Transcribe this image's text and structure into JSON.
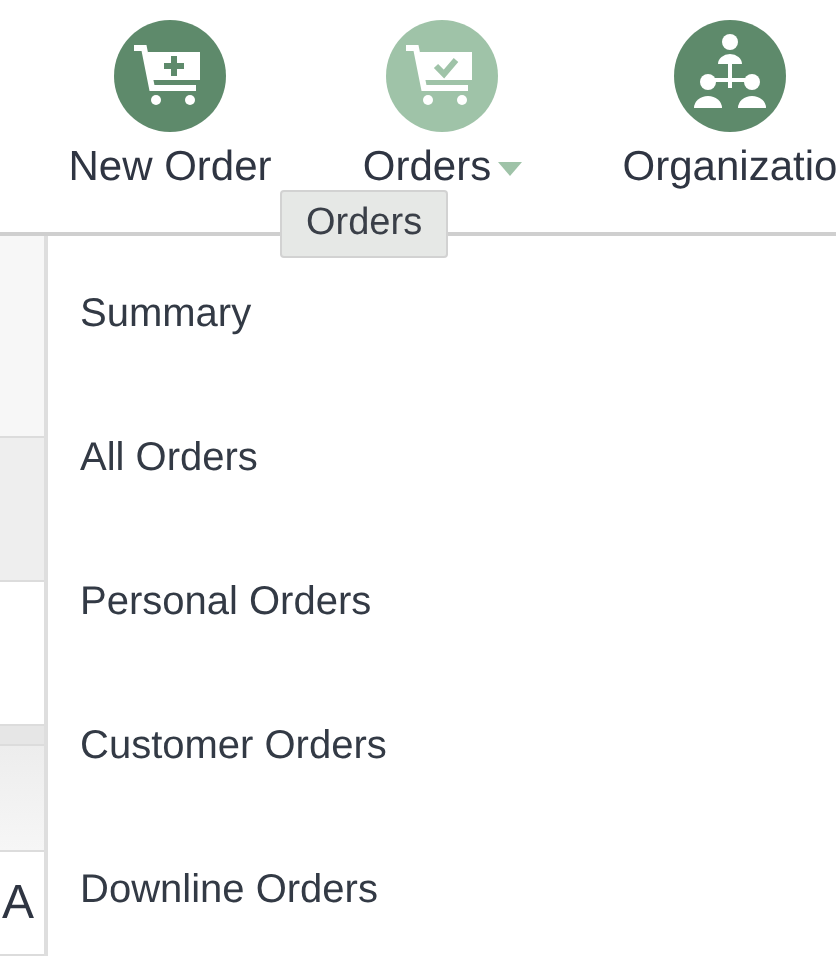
{
  "toolbar": {
    "items": [
      {
        "label": "New Order",
        "selected": false,
        "dropdown": false
      },
      {
        "label": "Orders",
        "selected": true,
        "dropdown": true
      },
      {
        "label": "Organizatio",
        "selected": false,
        "dropdown": false
      }
    ]
  },
  "tooltip": {
    "text": "Orders"
  },
  "background": {
    "cut_text": "A"
  },
  "menu": {
    "items": [
      {
        "label": "Summary"
      },
      {
        "label": "All Orders"
      },
      {
        "label": "Personal Orders"
      },
      {
        "label": "Customer Orders"
      },
      {
        "label": "Downline Orders"
      }
    ]
  }
}
